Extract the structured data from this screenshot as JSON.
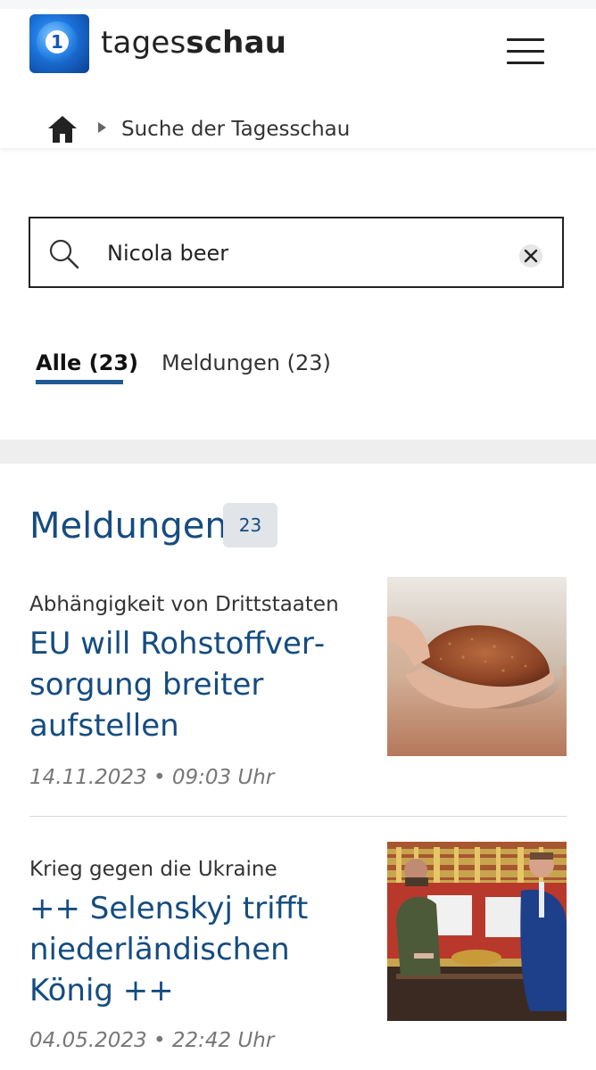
{
  "header": {
    "logo_mark": "1",
    "brand_light": "tages",
    "brand_bold": "schau",
    "menu_icon": "hamburger-icon"
  },
  "breadcrumb": {
    "home_icon": "home-icon",
    "label": "Suche der Tagesschau"
  },
  "search": {
    "value": "Nicola beer",
    "search_icon": "magnifier-icon",
    "clear_icon": "close-circle-icon"
  },
  "tabs": [
    {
      "label": "Alle (23)",
      "active": true
    },
    {
      "label": "Meldungen (23)",
      "active": false
    }
  ],
  "section": {
    "title": "Meldungen",
    "count": "23"
  },
  "articles": [
    {
      "topline": "Abhängigkeit von Drittstaaten",
      "headline": "EU will Rohstoffver­sorgung breiter aufstellen",
      "meta": "14.11.2023 • 09:03 Uhr",
      "image": "hands-holding-copper-granules"
    },
    {
      "topline": "Krieg gegen die Ukraine",
      "headline": "++ Selenskyj trifft niederländischen König ++",
      "meta": "04.05.2023 • 22:42 Uhr",
      "image": "two-men-seated-meeting"
    }
  ],
  "colors": {
    "accent": "#154c80",
    "tab_underline": "#1f5a93",
    "badge_bg": "#e1e4e9",
    "band": "#eeeeee"
  }
}
